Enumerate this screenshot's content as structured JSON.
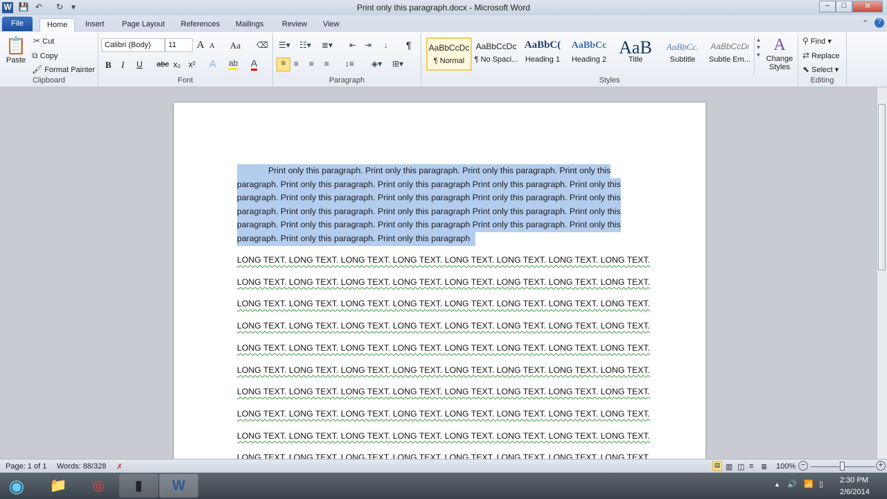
{
  "window": {
    "title": "Print only this paragraph.docx - Microsoft Word",
    "app_icon": "W"
  },
  "quick_access": {
    "save": "save-icon",
    "undo": "undo-icon",
    "redo": "redo-icon",
    "customize": "customize-icon"
  },
  "tabs": [
    {
      "label": "File"
    },
    {
      "label": "Home"
    },
    {
      "label": "Insert"
    },
    {
      "label": "Page Layout"
    },
    {
      "label": "References"
    },
    {
      "label": "Mailings"
    },
    {
      "label": "Review"
    },
    {
      "label": "View"
    }
  ],
  "ribbon": {
    "clipboard": {
      "label": "Clipboard",
      "paste": "Paste",
      "cut": "Cut",
      "copy": "Copy",
      "format_painter": "Format Painter"
    },
    "font": {
      "label": "Font",
      "name": "Calibri (Body)",
      "size": "11",
      "bold": "B",
      "italic": "I",
      "underline": "U",
      "strike": "abc",
      "sub": "x₂",
      "sup": "x²",
      "grow": "A",
      "shrink": "A",
      "case": "Aa"
    },
    "paragraph": {
      "label": "Paragraph",
      "pilcrow": "¶"
    },
    "styles": {
      "label": "Styles",
      "items": [
        {
          "preview": "AaBbCcDc",
          "name": "¶ Normal"
        },
        {
          "preview": "AaBbCcDc",
          "name": "¶ No Spaci..."
        },
        {
          "preview": "AaBbC(",
          "name": "Heading 1"
        },
        {
          "preview": "AaBbCc",
          "name": "Heading 2"
        },
        {
          "preview": "AaB",
          "name": "Title"
        },
        {
          "preview": "AaBbCc.",
          "name": "Subtitle"
        },
        {
          "preview": "AaBbCcDι",
          "name": "Subtle Em..."
        }
      ],
      "change_styles": "Change Styles"
    },
    "editing": {
      "label": "Editing",
      "find": "Find",
      "replace": "Replace",
      "select": "Select"
    }
  },
  "document": {
    "selected_paragraph": [
      "Print only this paragraph. Print only this paragraph. Print only this paragraph. Print only this",
      "paragraph. Print only this paragraph. Print only this paragraph Print only this paragraph. Print only this",
      "paragraph. Print only this paragraph. Print only this paragraph Print only this paragraph. Print only this",
      "paragraph. Print only this paragraph. Print only this paragraph Print only this paragraph. Print only this",
      "paragraph. Print only this paragraph. Print only this paragraph Print only this paragraph. Print only this",
      "paragraph. Print only this paragraph. Print only this paragraph"
    ],
    "long_lines": [
      "LONG TEXT. LONG TEXT. LONG TEXT. LONG TEXT. LONG TEXT. LONG TEXT. LONG TEXT. LONG TEXT.",
      "LONG TEXT. LONG TEXT. LONG TEXT. LONG TEXT. LONG TEXT. LONG TEXT. LONG TEXT. LONG TEXT.",
      "LONG TEXT. LONG TEXT. LONG TEXT. LONG TEXT. LONG TEXT. LONG TEXT. LONG TEXT. LONG TEXT.",
      "LONG TEXT. LONG TEXT. LONG TEXT. LONG TEXT. LONG TEXT. LONG TEXT. LONG TEXT. LONG TEXT.",
      "LONG TEXT. LONG TEXT. LONG TEXT. LONG TEXT. LONG TEXT. LONG TEXT. LONG TEXT. LONG TEXT.",
      "LONG TEXT. LONG TEXT. LONG TEXT. LONG TEXT. LONG TEXT. LONG TEXT. LONG TEXT. LONG TEXT.",
      "LONG TEXT. LONG TEXT. LONG TEXT. LONG TEXT. LONG TEXT. LONG TEXT. LONG TEXT. LONG TEXT.",
      "LONG TEXT. LONG TEXT. LONG TEXT. LONG TEXT. LONG TEXT. LONG TEXT. LONG TEXT. LONG TEXT.",
      "LONG TEXT. LONG TEXT. LONG TEXT. LONG TEXT. LONG TEXT. LONG TEXT. LONG TEXT. LONG TEXT.",
      "LONG TEXT. LONG TEXT. LONG TEXT. LONG TEXT. LONG TEXT. LONG TEXT. LONG TEXT. LONG TEXT."
    ],
    "selection_color": "#b3cdef"
  },
  "status": {
    "page": "Page: 1 of 1",
    "words": "Words: 88/328",
    "zoom": "100%",
    "zoom_out": "−",
    "zoom_in": "+"
  },
  "taskbar": {
    "time": "2:30 PM",
    "date": "2/6/2014"
  }
}
